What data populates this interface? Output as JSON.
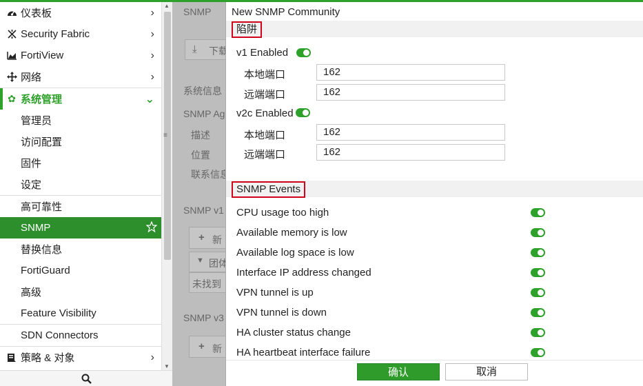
{
  "sidebar": {
    "items": [
      {
        "label": "仪表板",
        "icon": "dashboard-icon"
      },
      {
        "label": "Security Fabric",
        "icon": "security-fabric-icon"
      },
      {
        "label": "FortiView",
        "icon": "chart-icon"
      },
      {
        "label": "网络",
        "icon": "network-arrows-icon"
      },
      {
        "label": "系统管理",
        "icon": "gear-icon"
      }
    ],
    "sub_items": [
      "管理员",
      "访问配置",
      "固件",
      "设定",
      "高可靠性",
      "SNMP",
      "替换信息",
      "FortiGuard",
      "高级",
      "Feature Visibility",
      "SDN Connectors"
    ],
    "last_item": {
      "label": "策略 & 对象",
      "icon": "policy-icon"
    }
  },
  "background": {
    "title": "SNMP",
    "download": "下载",
    "system_info": "系统信息",
    "snmp_agent": "SNMP Ag",
    "desc": "描述",
    "location": "位置",
    "contact": "联系信息",
    "snmp_v1": "SNMP v1",
    "new1": "新",
    "filter": "团体",
    "not_found": "未找到",
    "snmp_v3": "SNMP v3",
    "new2": "新"
  },
  "panel": {
    "title": "New SNMP Community",
    "trap_section": "陷阱",
    "v1_enabled": "v1 Enabled",
    "v2c_enabled": "v2c Enabled",
    "local_port_label": "本地端口",
    "remote_port_label": "远端端口",
    "v1_local_port": "162",
    "v1_remote_port": "162",
    "v2c_local_port": "162",
    "v2c_remote_port": "162",
    "events_section": "SNMP Events",
    "events": [
      "CPU usage too high",
      "Available memory is low",
      "Available log space is low",
      "Interface IP address changed",
      "VPN tunnel is up",
      "VPN tunnel is down",
      "HA cluster status change",
      "HA heartbeat interface failure"
    ],
    "ok": "确认",
    "cancel": "取消"
  },
  "colors": {
    "accent": "#2ea12b",
    "highlight_box": "#d0021b"
  }
}
